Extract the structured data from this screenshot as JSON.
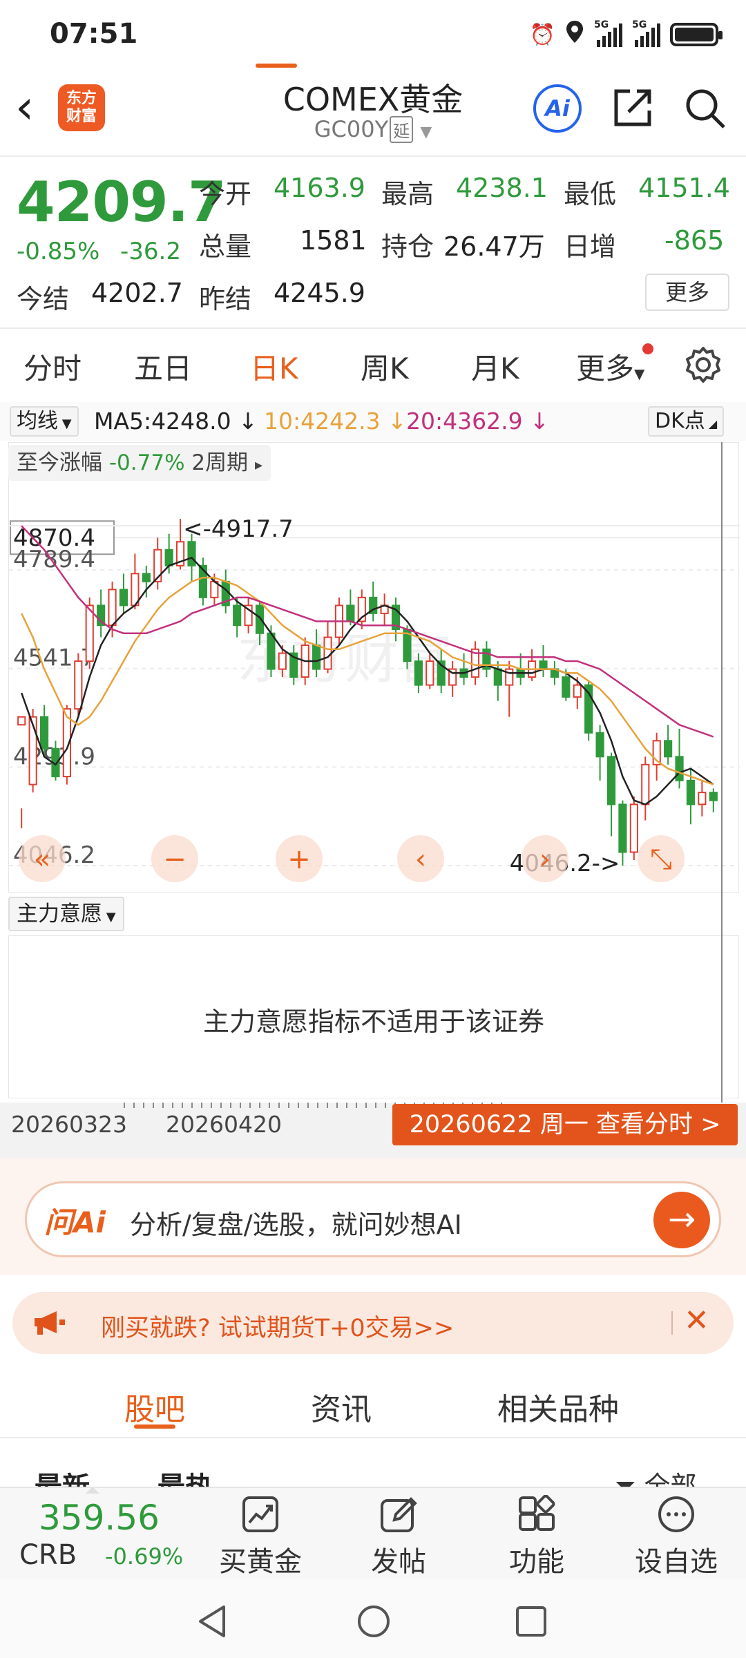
{
  "status": {
    "time": "07:51",
    "net1": "5G",
    "net2": "5G"
  },
  "header": {
    "logo_line1": "东方",
    "logo_line2": "财富",
    "title": "COMEX黄金",
    "code": "GC00Y",
    "delay_tag": "延",
    "ai_label": "Ai"
  },
  "quote": {
    "price": "4209.7",
    "change_pct": "-0.85%",
    "change_abs": "-36.2",
    "open_label": "今开",
    "open": "4163.9",
    "high_label": "最高",
    "high": "4238.1",
    "low_label": "最低",
    "low": "4151.4",
    "volume_label": "总量",
    "volume": "1581",
    "oi_label": "持仓",
    "oi": "26.47万",
    "daychg_label": "日增",
    "daychg": "-865",
    "settle_label": "今结",
    "settle": "4202.7",
    "prev_settle_label": "昨结",
    "prev_settle": "4245.9",
    "more": "更多"
  },
  "period_tabs": [
    "分时",
    "五日",
    "日K",
    "周K",
    "月K",
    "更多"
  ],
  "active_period": "日K",
  "ma_bar": {
    "selector": "均线",
    "ma5": "MA5:4248.0",
    "ma10": "10:4242.3",
    "ma20": "20:4362.9",
    "dk": "DK点",
    "colors": {
      "ma5": "#222222",
      "ma10": "#e8a23a",
      "ma20": "#c2307c"
    }
  },
  "chart": {
    "gain_label": "至今涨幅",
    "gain_value": "-0.77%",
    "gain_period": "2周期",
    "y_ticks": [
      "4870.4",
      "4789.4",
      "4541.7",
      "4293.9",
      "4046.2"
    ],
    "max_annotation": "<-4917.7",
    "min_annotation": "4046.2->",
    "watermark": "东方财富",
    "up_color": "#e03c31",
    "down_color": "#2f9a3c"
  },
  "chart_data": {
    "type": "candlestick",
    "ylim": [
      4046.2,
      4917.7
    ],
    "high_annotation": 4917.7,
    "low_annotation": 4046.2,
    "x_ticks": [
      "20260323",
      "20260420"
    ],
    "candles": [
      [
        4400,
        4420,
        4190,
        4140
      ],
      [
        4250,
        4420,
        4440,
        4230
      ],
      [
        4420,
        4340,
        4450,
        4320
      ],
      [
        4340,
        4270,
        4360,
        4260
      ],
      [
        4270,
        4440,
        4450,
        4250
      ],
      [
        4440,
        4560,
        4580,
        4420
      ],
      [
        4560,
        4700,
        4720,
        4540
      ],
      [
        4700,
        4650,
        4740,
        4620
      ],
      [
        4650,
        4740,
        4760,
        4620
      ],
      [
        4740,
        4700,
        4780,
        4680
      ],
      [
        4700,
        4780,
        4830,
        4690
      ],
      [
        4780,
        4760,
        4800,
        4720
      ],
      [
        4760,
        4840,
        4870,
        4740
      ],
      [
        4840,
        4800,
        4880,
        4780
      ],
      [
        4800,
        4860,
        4917.7,
        4790
      ],
      [
        4860,
        4800,
        4880,
        4760
      ],
      [
        4800,
        4720,
        4820,
        4700
      ],
      [
        4720,
        4760,
        4780,
        4700
      ],
      [
        4760,
        4700,
        4790,
        4680
      ],
      [
        4700,
        4650,
        4720,
        4620
      ],
      [
        4650,
        4700,
        4720,
        4630
      ],
      [
        4700,
        4630,
        4710,
        4600
      ],
      [
        4630,
        4540,
        4650,
        4520
      ],
      [
        4540,
        4580,
        4600,
        4520
      ],
      [
        4580,
        4520,
        4600,
        4500
      ],
      [
        4520,
        4600,
        4620,
        4500
      ],
      [
        4600,
        4540,
        4640,
        4520
      ],
      [
        4540,
        4620,
        4660,
        4530
      ],
      [
        4620,
        4700,
        4720,
        4600
      ],
      [
        4700,
        4660,
        4740,
        4650
      ],
      [
        4660,
        4720,
        4740,
        4640
      ],
      [
        4720,
        4680,
        4760,
        4660
      ],
      [
        4680,
        4700,
        4730,
        4650
      ],
      [
        4700,
        4640,
        4720,
        4610
      ],
      [
        4640,
        4560,
        4650,
        4540
      ],
      [
        4560,
        4500,
        4580,
        4480
      ],
      [
        4500,
        4560,
        4580,
        4490
      ],
      [
        4560,
        4500,
        4590,
        4480
      ],
      [
        4500,
        4540,
        4560,
        4470
      ],
      [
        4540,
        4520,
        4580,
        4500
      ],
      [
        4520,
        4590,
        4610,
        4500
      ],
      [
        4590,
        4540,
        4610,
        4520
      ],
      [
        4540,
        4500,
        4560,
        4460
      ],
      [
        4500,
        4540,
        4560,
        4420
      ],
      [
        4540,
        4520,
        4580,
        4500
      ],
      [
        4520,
        4560,
        4590,
        4510
      ],
      [
        4560,
        4540,
        4600,
        4520
      ],
      [
        4540,
        4520,
        4560,
        4500
      ],
      [
        4520,
        4470,
        4540,
        4460
      ],
      [
        4470,
        4500,
        4520,
        4440
      ],
      [
        4500,
        4380,
        4510,
        4360
      ],
      [
        4380,
        4320,
        4400,
        4260
      ],
      [
        4320,
        4200,
        4330,
        4120
      ],
      [
        4200,
        4080,
        4210,
        4046.2
      ],
      [
        4080,
        4200,
        4220,
        4060
      ],
      [
        4200,
        4300,
        4320,
        4160
      ],
      [
        4300,
        4360,
        4380,
        4260
      ],
      [
        4360,
        4320,
        4400,
        4300
      ],
      [
        4320,
        4260,
        4390,
        4240
      ],
      [
        4260,
        4200,
        4290,
        4150
      ],
      [
        4200,
        4230,
        4260,
        4170
      ],
      [
        4230,
        4210,
        4240,
        4180
      ]
    ],
    "ma": [
      {
        "name": "MA5",
        "color": "#222222",
        "values": [
          4480,
          4400,
          4320,
          4300,
          4340,
          4420,
          4520,
          4600,
          4650,
          4680,
          4700,
          4740,
          4770,
          4800,
          4810,
          4820,
          4790,
          4760,
          4740,
          4710,
          4690,
          4670,
          4630,
          4590,
          4570,
          4560,
          4560,
          4570,
          4600,
          4640,
          4670,
          4690,
          4700,
          4690,
          4660,
          4620,
          4580,
          4550,
          4530,
          4530,
          4540,
          4550,
          4540,
          4530,
          4530,
          4530,
          4540,
          4540,
          4530,
          4510,
          4480,
          4430,
          4360,
          4270,
          4210,
          4200,
          4220,
          4250,
          4280,
          4290,
          4270,
          4250
        ]
      },
      {
        "name": "MA10",
        "color": "#e8a23a",
        "values": [
          4680,
          4620,
          4540,
          4480,
          4420,
          4400,
          4420,
          4460,
          4510,
          4560,
          4610,
          4650,
          4690,
          4720,
          4740,
          4760,
          4770,
          4770,
          4760,
          4750,
          4730,
          4710,
          4680,
          4650,
          4630,
          4610,
          4600,
          4590,
          4590,
          4600,
          4610,
          4620,
          4630,
          4630,
          4630,
          4620,
          4610,
          4590,
          4570,
          4560,
          4550,
          4550,
          4550,
          4550,
          4540,
          4540,
          4540,
          4540,
          4530,
          4530,
          4510,
          4490,
          4460,
          4420,
          4380,
          4340,
          4310,
          4290,
          4280,
          4270,
          4260,
          4250
        ]
      },
      {
        "name": "MA20",
        "color": "#c2307c",
        "values": [
          4900,
          4870,
          4840,
          4800,
          4760,
          4720,
          4690,
          4660,
          4640,
          4630,
          4630,
          4630,
          4640,
          4650,
          4660,
          4680,
          4690,
          4700,
          4710,
          4720,
          4720,
          4710,
          4700,
          4690,
          4680,
          4670,
          4660,
          4660,
          4660,
          4660,
          4650,
          4650,
          4650,
          4650,
          4640,
          4630,
          4620,
          4610,
          4600,
          4590,
          4580,
          4580,
          4570,
          4570,
          4570,
          4570,
          4570,
          4570,
          4560,
          4560,
          4550,
          4540,
          4520,
          4500,
          4480,
          4460,
          4440,
          4420,
          4400,
          4390,
          4380,
          4370
        ]
      }
    ]
  },
  "chart_controls": [
    "«",
    "−",
    "+",
    "‹",
    "›",
    "⤡"
  ],
  "indicator": {
    "selector": "主力意愿",
    "message": "主力意愿指标不适用于该证券"
  },
  "date_axis": {
    "d1": "20260323",
    "d2": "20260420",
    "button": "20260622 周一  查看分时 >"
  },
  "ai_bar": {
    "logo": "问Ai",
    "placeholder": "分析/复盘/选股，就问妙想AI"
  },
  "promo": {
    "text": "刚买就跌?  试试期货T+0交易>>"
  },
  "bottom_tabs": [
    "股吧",
    "资讯",
    "相关品种"
  ],
  "sort": {
    "latest": "最新",
    "hot": "最热",
    "filter": "全部"
  },
  "toolbar": {
    "ticker_value": "359.56",
    "ticker_name": "CRB",
    "ticker_change": "-0.69%",
    "buy_gold": "买黄金",
    "post": "发帖",
    "functions": "功能",
    "watchlist": "设自选"
  }
}
